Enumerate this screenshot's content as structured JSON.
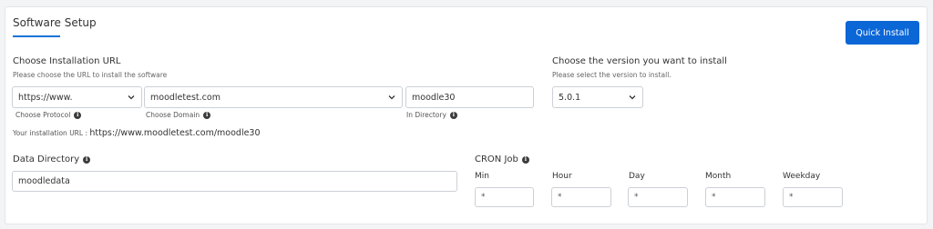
{
  "header": {
    "title": "Software Setup",
    "quick_install_label": "Quick Install"
  },
  "install_url": {
    "heading": "Choose Installation URL",
    "hint": "Please choose the URL to install the software",
    "protocol": {
      "value": "https://www.",
      "label": "Choose Protocol"
    },
    "domain": {
      "value": "moodletest.com",
      "label": "Choose Domain"
    },
    "directory": {
      "value": "moodle30",
      "label": "In Directory"
    },
    "your_url_label": "Your installation URL :",
    "your_url_value": "https://www.moodletest.com/moodle30"
  },
  "version": {
    "heading": "Choose the version you want to install",
    "hint": "Please select the version to install.",
    "value": "5.0.1"
  },
  "data_directory": {
    "heading": "Data Directory",
    "value": "moodledata"
  },
  "cron": {
    "heading": "CRON Job",
    "fields": [
      {
        "label": "Min",
        "value": "*"
      },
      {
        "label": "Hour",
        "value": "*"
      },
      {
        "label": "Day",
        "value": "*"
      },
      {
        "label": "Month",
        "value": "*"
      },
      {
        "label": "Weekday",
        "value": "*"
      }
    ]
  },
  "icons": {
    "info": "info-icon",
    "dropdown": "chevron-down-icon"
  },
  "colors": {
    "accent": "#0b66d6",
    "background": "#f3f4f6"
  }
}
